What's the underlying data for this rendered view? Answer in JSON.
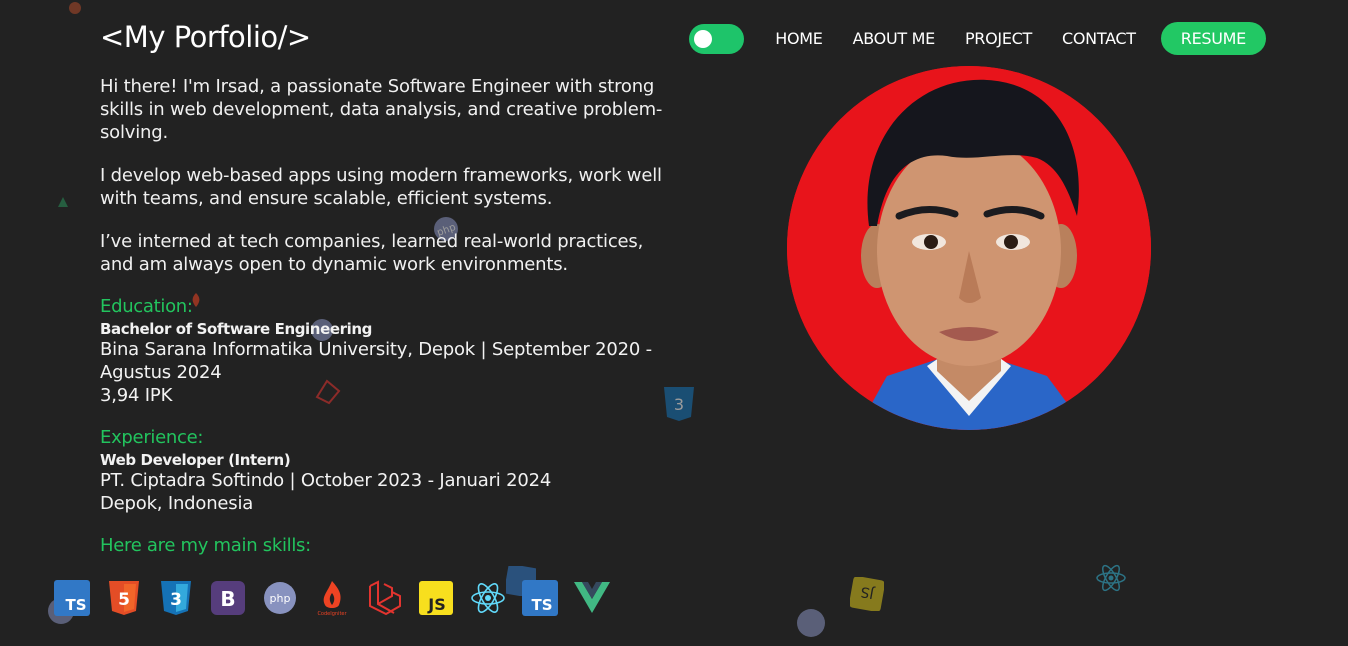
{
  "header": {
    "logo": "<My Porfolio/>",
    "theme_toggle": "on",
    "nav": [
      {
        "label": "HOME"
      },
      {
        "label": "ABOUT ME"
      },
      {
        "label": "PROJECT"
      },
      {
        "label": "CONTACT"
      }
    ],
    "resume_label": "RESUME"
  },
  "about": {
    "intro": "Hi there! I'm Irsad, a passionate Software Engineer with strong skills in web development, data analysis, and creative problem-solving.",
    "work": "I develop web-based apps using modern frameworks, work well with teams, and ensure scalable, efficient systems.",
    "intern": "I’ve interned at tech companies, learned real-world practices, and am always open to dynamic work environments."
  },
  "education": {
    "title": "Education:",
    "degree": "Bachelor of Software Engineering",
    "school": "Bina Sarana Informatika University, Depok | September 2020 - Agustus 2024",
    "gpa": "3,94 IPK"
  },
  "experience": {
    "title": "Experience:",
    "role": "Web Developer (Intern)",
    "company": "PT. Ciptadra Softindo | October 2023 - Januari 2024",
    "location": "Depok, Indonesia"
  },
  "skills": {
    "title": "Here are my main skills:",
    "icons": [
      "typescript-icon",
      "html5-icon",
      "css3-icon",
      "bootstrap-icon",
      "php-icon",
      "codeigniter-icon",
      "laravel-icon",
      "javascript-icon",
      "react-icon",
      "typescript-icon",
      "vue-icon"
    ]
  },
  "colors": {
    "background": "#222222",
    "accent": "#22c864",
    "photo_bg": "#e8141b"
  }
}
